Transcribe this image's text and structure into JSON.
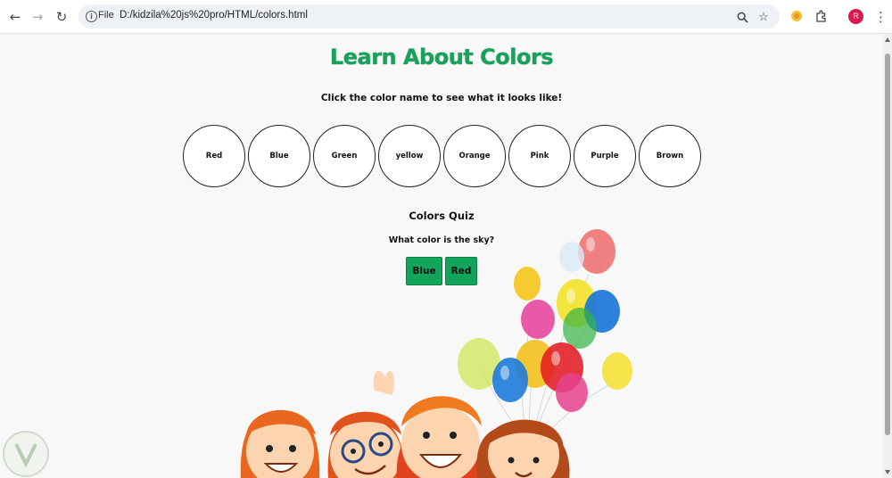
{
  "browser": {
    "back_icon": "arrow-left-icon",
    "forward_icon": "arrow-right-icon",
    "reload_icon": "reload-icon",
    "scheme_label": "File",
    "url": "D:/kidzila%20js%20pro/HTML/colors.html",
    "avatar_letter": "R"
  },
  "page": {
    "title": "Learn About Colors",
    "instruction": "Click the color name to see what it looks like!",
    "colors": [
      "Red",
      "Blue",
      "Green",
      "yellow",
      "Orange",
      "Pink",
      "Purple",
      "Brown"
    ],
    "quiz": {
      "title": "Colors Quiz",
      "question": "What color is the sky?",
      "answers": [
        "Blue",
        "Red"
      ]
    }
  },
  "colors_meta": {
    "title_color": "#17a15a",
    "button_color": "#13a45c"
  }
}
